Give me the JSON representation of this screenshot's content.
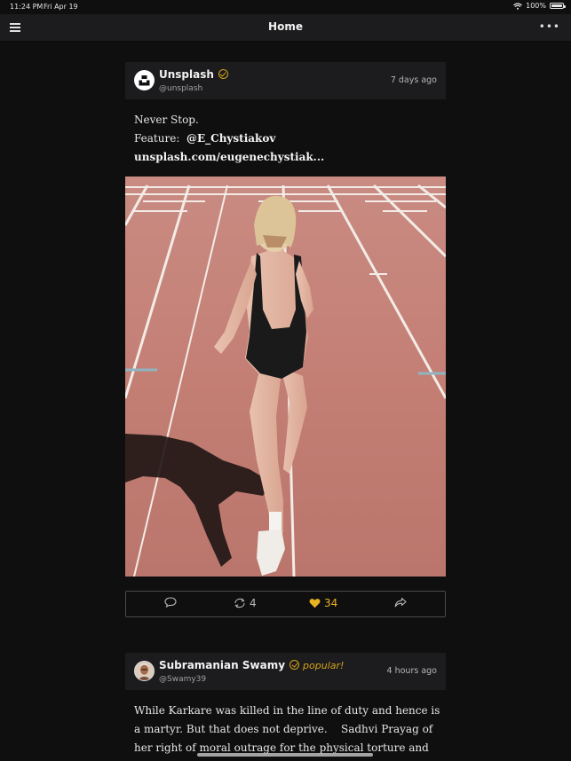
{
  "status_bar": {
    "time": "11:24 PM",
    "date": "Fri Apr 19",
    "battery": "100%"
  },
  "nav": {
    "title": "Home"
  },
  "posts": [
    {
      "author": "Unsplash",
      "handle": "@unsplash",
      "time_ago": "7 days ago",
      "text_lines": [
        "Never Stop."
      ],
      "feature_label": "Feature:",
      "feature_user": "@E_Chystiakov",
      "link": "unsplash.com/eugenechystiak...",
      "actions": {
        "reposts": "4",
        "likes": "34"
      }
    },
    {
      "author": "Subramanian Swamy",
      "badge": "popular!",
      "handle": "@Swamy39",
      "time_ago": "4 hours ago",
      "text_lines": [
        "While Karkare was killed in the line of duty and hence is",
        "a martyr. But that does not deprive.    Sadhvi Prayag of",
        "her right of moral outrage for the physical torture and"
      ]
    }
  ],
  "colors": {
    "accent": "#d4a418",
    "like": "#e8b323",
    "background": "#0f0f10",
    "card": "#1c1c1e"
  }
}
